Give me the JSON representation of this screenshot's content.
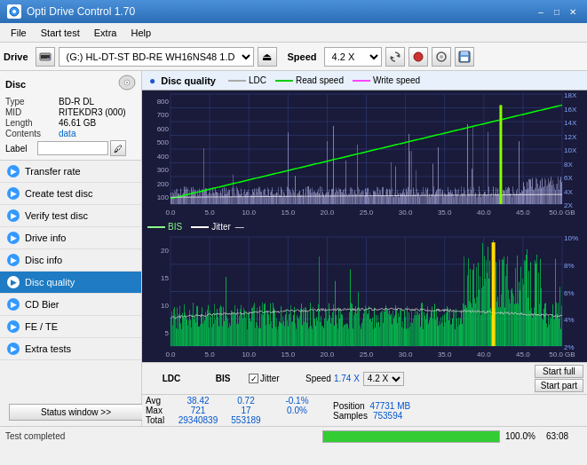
{
  "titleBar": {
    "title": "Opti Drive Control 1.70",
    "controls": [
      "minimize",
      "maximize",
      "close"
    ]
  },
  "menuBar": {
    "items": [
      "File",
      "Start test",
      "Extra",
      "Help"
    ]
  },
  "toolbar": {
    "driveLabel": "Drive",
    "driveValue": "(G:)  HL-DT-ST BD-RE  WH16NS48 1.D3",
    "speedLabel": "Speed",
    "speedValue": "4.2 X"
  },
  "sidebar": {
    "disc": {
      "title": "Disc",
      "typeLabel": "Type",
      "typeValue": "BD-R DL",
      "midLabel": "MID",
      "midValue": "RITEKDR3 (000)",
      "lengthLabel": "Length",
      "lengthValue": "46.61 GB",
      "contentsLabel": "Contents",
      "contentsValue": "data",
      "labelLabel": "Label",
      "labelValue": ""
    },
    "navItems": [
      {
        "id": "transfer-rate",
        "label": "Transfer rate",
        "active": false
      },
      {
        "id": "create-test-disc",
        "label": "Create test disc",
        "active": false
      },
      {
        "id": "verify-test-disc",
        "label": "Verify test disc",
        "active": false
      },
      {
        "id": "drive-info",
        "label": "Drive info",
        "active": false
      },
      {
        "id": "disc-info",
        "label": "Disc info",
        "active": false
      },
      {
        "id": "disc-quality",
        "label": "Disc quality",
        "active": true
      },
      {
        "id": "cd-bier",
        "label": "CD Bier",
        "active": false
      },
      {
        "id": "fe-te",
        "label": "FE / TE",
        "active": false
      },
      {
        "id": "extra-tests",
        "label": "Extra tests",
        "active": false
      }
    ],
    "statusWindowBtn": "Status window >>"
  },
  "chartPanel": {
    "title": "Disc quality",
    "upperLegend": {
      "ldc": "LDC",
      "readSpeed": "Read speed",
      "writeSpeed": "Write speed"
    },
    "upperYAxisLabels": [
      "800",
      "700",
      "600",
      "500",
      "400",
      "300",
      "200",
      "100"
    ],
    "upperYAxisRight": [
      "18X",
      "16X",
      "14X",
      "12X",
      "10X",
      "8X",
      "6X",
      "4X",
      "2X"
    ],
    "xAxisLabels": [
      "0.0",
      "5.0",
      "10.0",
      "15.0",
      "20.0",
      "25.0",
      "30.0",
      "35.0",
      "40.0",
      "45.0",
      "50.0 GB"
    ],
    "lowerLegend": {
      "bis": "BIS",
      "jitter": "Jitter"
    },
    "lowerYAxisLabels": [
      "20",
      "15",
      "10",
      "5"
    ],
    "lowerYAxisRight": [
      "10%",
      "8%",
      "6%",
      "4%",
      "2%"
    ]
  },
  "statsBar": {
    "columns": {
      "ldc": {
        "label": "LDC",
        "avg": "38.42",
        "max": "721",
        "total": "29340839"
      },
      "bis": {
        "label": "BIS",
        "avg": "0.72",
        "max": "17",
        "total": "553189"
      },
      "jitter": {
        "label": "Jitter",
        "avg": "-0.1%",
        "max": "0.0%",
        "total": ""
      },
      "speed": {
        "label": "Speed",
        "value": "1.74 X",
        "speedSelect": "4.2 X"
      },
      "position": {
        "label": "Position",
        "value": "47731 MB"
      },
      "samples": {
        "label": "Samples",
        "value": "753594"
      }
    },
    "avgLabel": "Avg",
    "maxLabel": "Max",
    "totalLabel": "Total",
    "startFull": "Start full",
    "startPart": "Start part"
  },
  "bottomBar": {
    "statusText": "Test completed",
    "progressPct": "100.0%",
    "elapsedTime": "63:08"
  }
}
